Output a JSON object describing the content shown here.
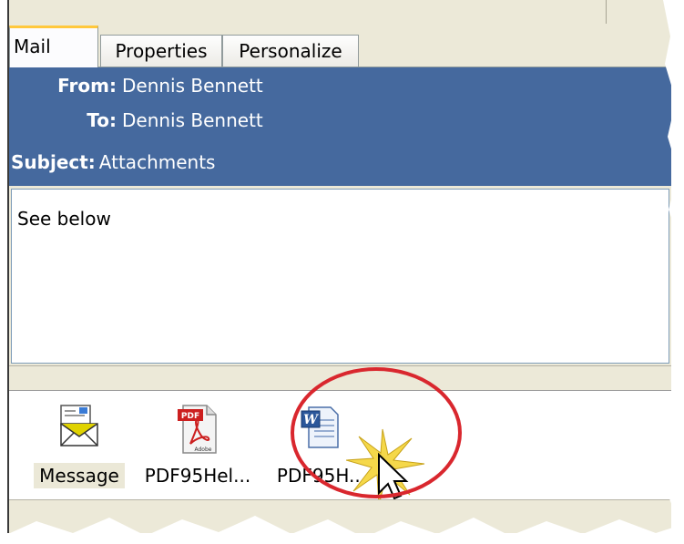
{
  "tabs": [
    {
      "label": "Mail",
      "active": true
    },
    {
      "label": "Properties",
      "active": false
    },
    {
      "label": "Personalize",
      "active": false
    }
  ],
  "header": {
    "from_label": "From:",
    "from_value": "Dennis Bennett",
    "to_label": "To:",
    "to_value": "Dennis Bennett",
    "subject_label": "Subject:",
    "subject_value": "Attachments"
  },
  "body": {
    "text": "See below"
  },
  "attachments": [
    {
      "label": "Message",
      "icon": "email-message-icon",
      "selected": true
    },
    {
      "label": "PDF95Hel...",
      "icon": "pdf-file-icon",
      "selected": false
    },
    {
      "label": "PDF95H...",
      "icon": "word-document-icon",
      "selected": false
    }
  ],
  "colors": {
    "header_bg": "#45699e",
    "tab_highlight": "#ffc83c",
    "annotation_circle": "#d9272e"
  }
}
